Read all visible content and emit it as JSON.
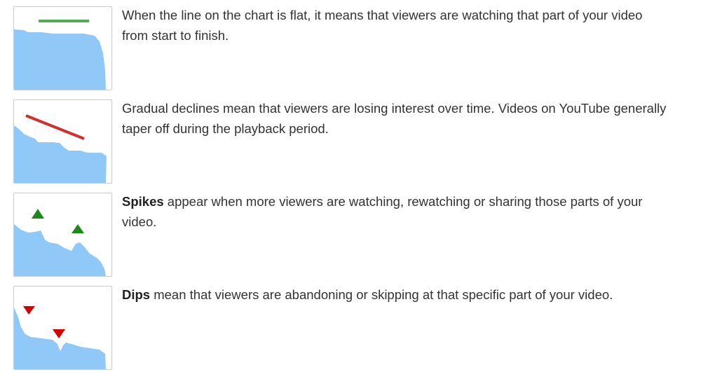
{
  "colors": {
    "area_fill": "#90c8f8",
    "flat_marker": "#4caf50",
    "decline_marker": "#d32f2f",
    "spike_marker": "#1b8a1b",
    "dip_marker": "#d50000"
  },
  "rows": [
    {
      "icon": "flat-retention-chart-icon",
      "bold": "",
      "text": "When the line on the chart is flat, it means that viewers are watching that part of your video from start to finish."
    },
    {
      "icon": "gradual-decline-chart-icon",
      "bold": "",
      "text": "Gradual declines mean that viewers are losing interest over time. Videos on YouTube generally taper off during the playback period."
    },
    {
      "icon": "spikes-chart-icon",
      "bold": "Spikes",
      "text": " appear when more viewers are watching, rewatching or sharing those parts of your video."
    },
    {
      "icon": "dips-chart-icon",
      "bold": "Dips",
      "text": " mean that viewers are abandoning or skipping at that specific part of your video."
    }
  ]
}
